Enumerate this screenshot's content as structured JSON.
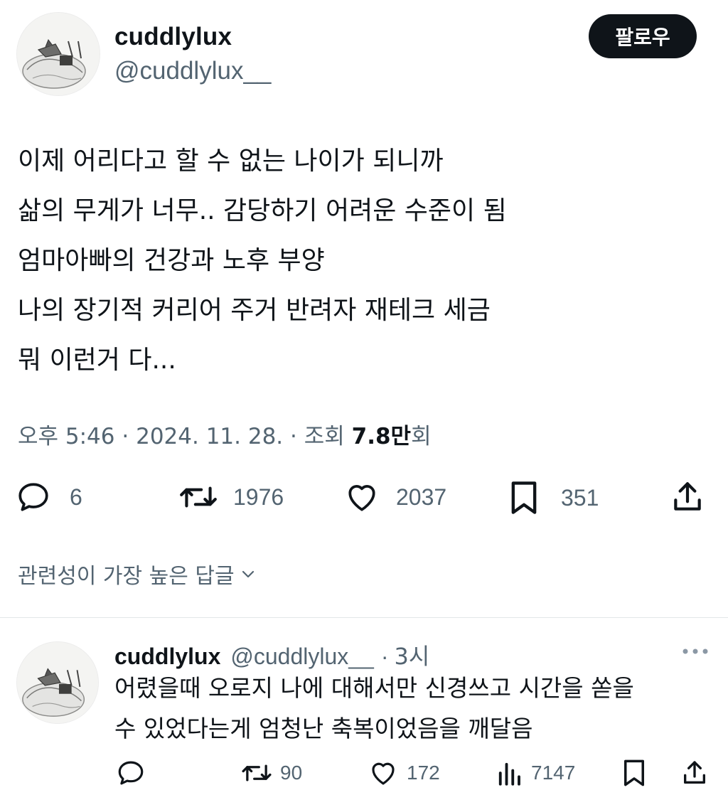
{
  "post": {
    "display_name": "cuddlylux",
    "handle": "@cuddlylux__",
    "follow_label": "팔로우",
    "lines": [
      "이제 어리다고 할 수 없는 나이가 되니까",
      "삶의 무게가 너무.. 감당하기 어려운 수준이 됨",
      "엄마아빠의 건강과 노후 부양",
      "나의 장기적 커리어 주거 반려자 재테크 세금",
      "뭐 이런거 다..."
    ],
    "time": "오후 5:46",
    "sep": "·",
    "date": "2024. 11. 28.",
    "views_prefix": "조회",
    "views_count": "7.8만",
    "views_suffix": "회",
    "stats": {
      "replies": "6",
      "reposts": "1976",
      "likes": "2037",
      "bookmarks": "351"
    }
  },
  "replies_sort": {
    "label": "관련성이 가장 높은 답글",
    "icon": "chevron-down-icon"
  },
  "reply": {
    "display_name": "cuddlylux",
    "handle": "@cuddlylux__",
    "sep": "·",
    "time": "3시",
    "more_icon": "more-icon",
    "lines": [
      "어렸을때 오로지 나에 대해서만 신경쓰고 시간을 쏟을",
      "수 있었다는게 엄청난 축복이었음을 깨달음"
    ],
    "stats": {
      "replies": "",
      "reposts": "90",
      "likes": "172",
      "views": "7147"
    }
  },
  "colors": {
    "text": "#0f1419",
    "secondary": "#536471",
    "button_bg": "#0f1419",
    "divider": "#e3e6e8"
  }
}
